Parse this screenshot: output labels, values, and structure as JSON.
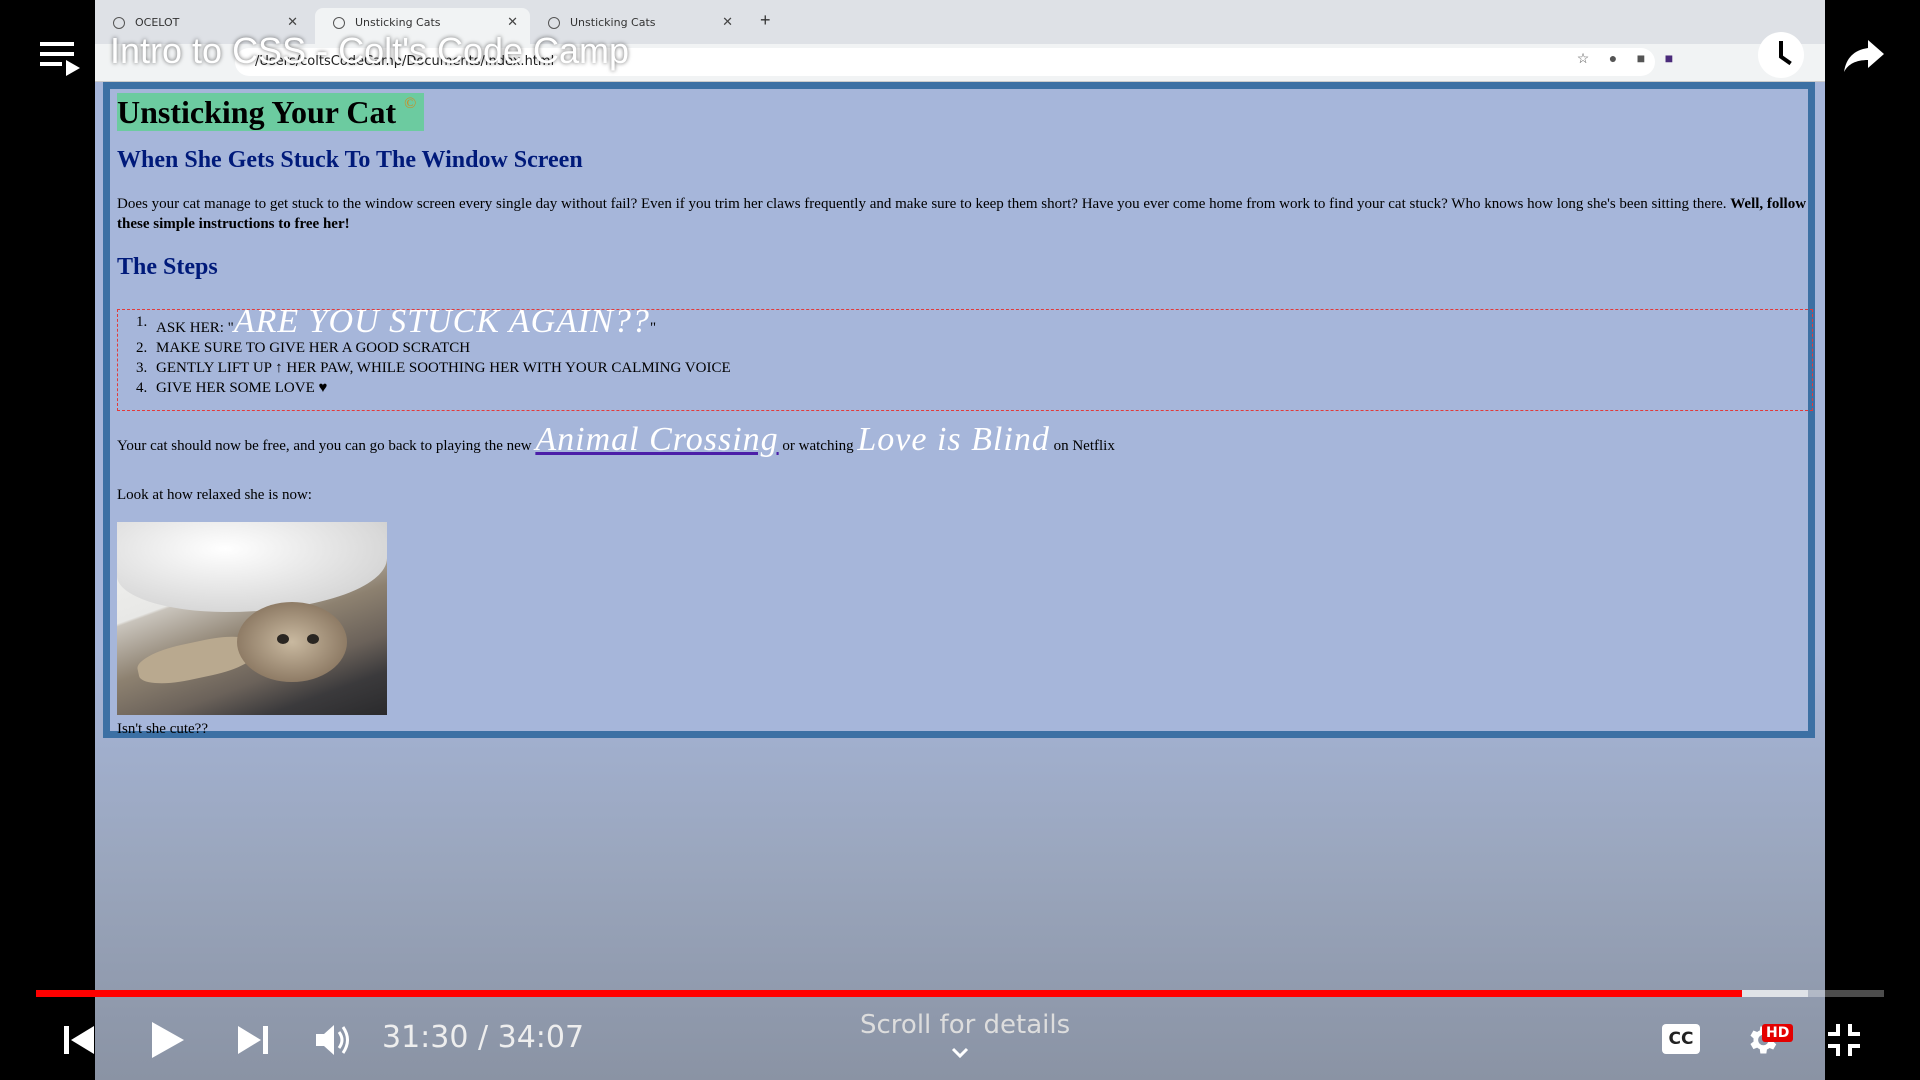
{
  "video": {
    "title": "Intro to CSS - Colt's Code Camp",
    "time_current": "31:30",
    "time_total": "34:07",
    "time_display": "31:30 / 34:07",
    "progress_fraction": 0.923,
    "buffered_fraction": 0.959,
    "scroll_hint": "Scroll for details",
    "cc_label": "CC",
    "hd_badge": "HD"
  },
  "browser": {
    "tabs": [
      {
        "label": "OCELOT"
      },
      {
        "label": "Unsticking Cats"
      },
      {
        "label": "Unsticking Cats"
      }
    ],
    "url": "/Users/coltsCodeCamp/Documents/index.html"
  },
  "page": {
    "h1": "Unsticking Your Cat",
    "h1_symbol": "©",
    "h2": "When She Gets Stuck To The Window Screen",
    "intro_text": "Does your cat manage to get stuck to the window screen every single day without fail? Even if you trim her claws frequently and make sure to keep them short? Have you ever come home from work to find your cat stuck? Who knows how long she's been sitting there.",
    "intro_bold": "Well, follow these simple instructions to free her!",
    "h3": "The Steps",
    "steps": [
      {
        "num": "1.",
        "prefix": "Ask her: \"",
        "fancy": "Are you stuck again??",
        "suffix": "\""
      },
      {
        "num": "2.",
        "text": "Make sure to give her a good scratch"
      },
      {
        "num": "3.",
        "text": "Gently lift up ↑ her paw, while soothing her with your calming voice"
      },
      {
        "num": "4.",
        "text": "Give her some love ♥"
      }
    ],
    "free_pre": "Your cat should now be free, and you can go back to playing the new",
    "free_link": "Animal Crossing",
    "free_mid": "or watching",
    "free_show": "Love is Blind",
    "free_post": "on Netflix",
    "relaxed": "Look at how relaxed she is now:",
    "caption": "Isn't she cute??"
  },
  "colors": {
    "progress": "#ff0000",
    "page_border": "#3c70a4",
    "page_bg": "#a6b6da",
    "h1_bg": "#6ccba0",
    "heading": "#001a7a",
    "dashed_border": "#e23a3a"
  },
  "icons": [
    "playlist-icon",
    "watch-later-icon",
    "share-icon",
    "previous-icon",
    "play-icon",
    "next-icon",
    "volume-icon",
    "settings-icon",
    "exit-fullscreen-icon"
  ]
}
